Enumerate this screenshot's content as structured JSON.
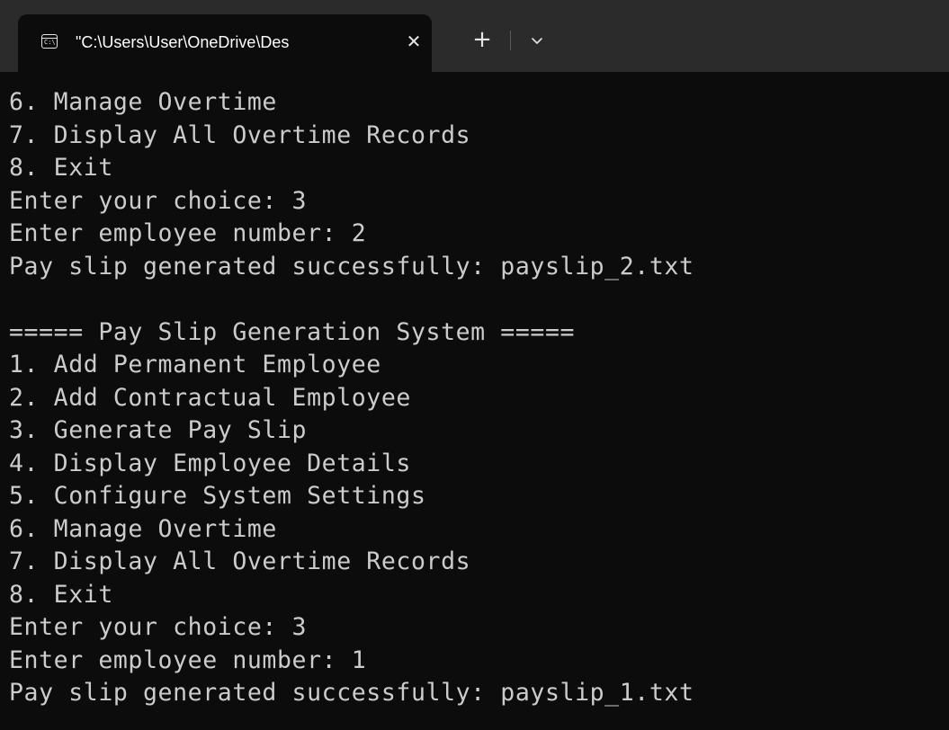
{
  "tab": {
    "icon": "terminal-icon",
    "icon_text": "C:\\",
    "title": "\"C:\\Users\\User\\OneDrive\\Des",
    "close_icon": "close-icon",
    "close_glyph": "✕",
    "new_tab_icon": "plus-icon",
    "new_tab_glyph": "+",
    "dropdown_icon": "chevron-down-icon"
  },
  "colors": {
    "background": "#0c0c0c",
    "tabbar": "#2b2b2b",
    "text": "#cccccc"
  },
  "console": {
    "lines": [
      "6. Manage Overtime",
      "7. Display All Overtime Records",
      "8. Exit",
      "Enter your choice: 3",
      "Enter employee number: 2",
      "Pay slip generated successfully: payslip_2.txt",
      "",
      "===== Pay Slip Generation System =====",
      "1. Add Permanent Employee",
      "2. Add Contractual Employee",
      "3. Generate Pay Slip",
      "4. Display Employee Details",
      "5. Configure System Settings",
      "6. Manage Overtime",
      "7. Display All Overtime Records",
      "8. Exit",
      "Enter your choice: 3",
      "Enter employee number: 1",
      "Pay slip generated successfully: payslip_1.txt"
    ]
  }
}
